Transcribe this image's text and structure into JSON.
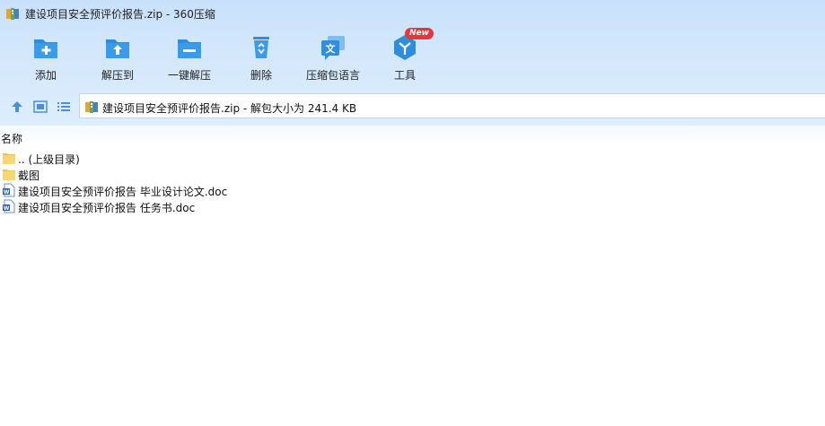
{
  "window": {
    "title": "建设项目安全预评价报告.zip - 360压缩",
    "app_icon": "zip-archive-icon"
  },
  "toolbar": {
    "buttons": [
      {
        "label": "添加",
        "icon": "add-folder-icon"
      },
      {
        "label": "解压到",
        "icon": "extract-to-folder-icon"
      },
      {
        "label": "一键解压",
        "icon": "one-click-extract-icon"
      },
      {
        "label": "删除",
        "icon": "recycle-bin-icon"
      },
      {
        "label": "压缩包语言",
        "icon": "language-icon"
      },
      {
        "label": "工具",
        "icon": "tools-icon",
        "badge": "New"
      }
    ]
  },
  "nav": {
    "path_text": "建设项目安全预评价报告.zip - 解包大小为 241.4 KB"
  },
  "columns": {
    "name": "名称"
  },
  "files": [
    {
      "name": ".. (上级目录)",
      "type": "folder"
    },
    {
      "name": "截图",
      "type": "folder"
    },
    {
      "name": "建设项目安全预评价报告 毕业设计论文.doc",
      "type": "doc"
    },
    {
      "name": "建设项目安全预评价报告 任务书.doc",
      "type": "doc"
    }
  ],
  "colors": {
    "accent_blue": "#2d8ee0",
    "toolbar_bg": "#d4e8fc",
    "badge_red": "#e8343b"
  }
}
